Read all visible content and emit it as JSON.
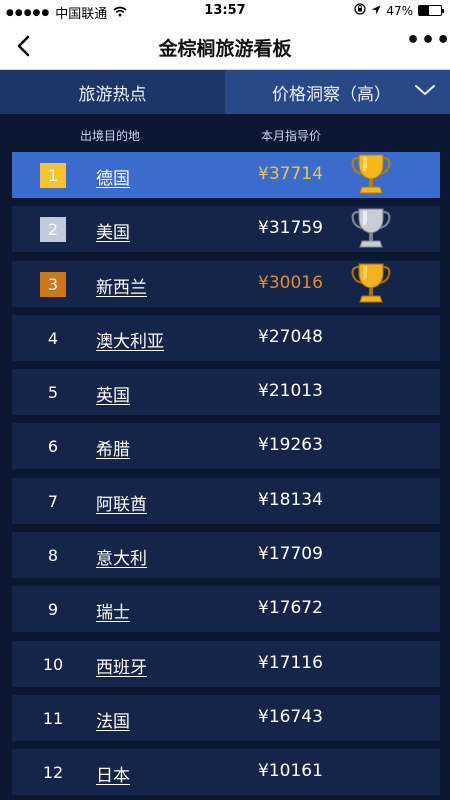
{
  "status_bar": {
    "carrier": "中国联通",
    "time": "13:57",
    "battery": "47%",
    "battery_level": 0.47
  },
  "nav": {
    "title": "金棕榈旅游看板",
    "more": "•••"
  },
  "tabs": {
    "hot": "旅游热点",
    "price": "价格洞察（高）"
  },
  "columns": {
    "destination": "出境目的地",
    "price": "本月指导价"
  },
  "rows": [
    {
      "rank": "1",
      "destination": "德国",
      "price": "¥37714",
      "medal": "gold"
    },
    {
      "rank": "2",
      "destination": "美国",
      "price": "¥31759",
      "medal": "silver"
    },
    {
      "rank": "3",
      "destination": "新西兰",
      "price": "¥30016",
      "medal": "bronze"
    },
    {
      "rank": "4",
      "destination": "澳大利亚",
      "price": "¥27048"
    },
    {
      "rank": "5",
      "destination": "英国",
      "price": "¥21013"
    },
    {
      "rank": "6",
      "destination": "希腊",
      "price": "¥19263"
    },
    {
      "rank": "7",
      "destination": "阿联酋",
      "price": "¥18134"
    },
    {
      "rank": "8",
      "destination": "意大利",
      "price": "¥17709"
    },
    {
      "rank": "9",
      "destination": "瑞士",
      "price": "¥17672"
    },
    {
      "rank": "10",
      "destination": "西班牙",
      "price": "¥17116"
    },
    {
      "rank": "11",
      "destination": "法国",
      "price": "¥16743"
    },
    {
      "rank": "12",
      "destination": "日本",
      "price": "¥10161"
    }
  ],
  "colors": {
    "background": "#0c1733",
    "row": "#152449",
    "highlight_row": "#3a6ccd",
    "gold": "#f6c432",
    "silver": "#c2cbdb",
    "bronze": "#c9781b"
  },
  "icons": {
    "back": "chevron-left-icon",
    "more": "ellipsis-icon",
    "dropdown": "chevron-down-icon",
    "trophy": "trophy-icon"
  }
}
